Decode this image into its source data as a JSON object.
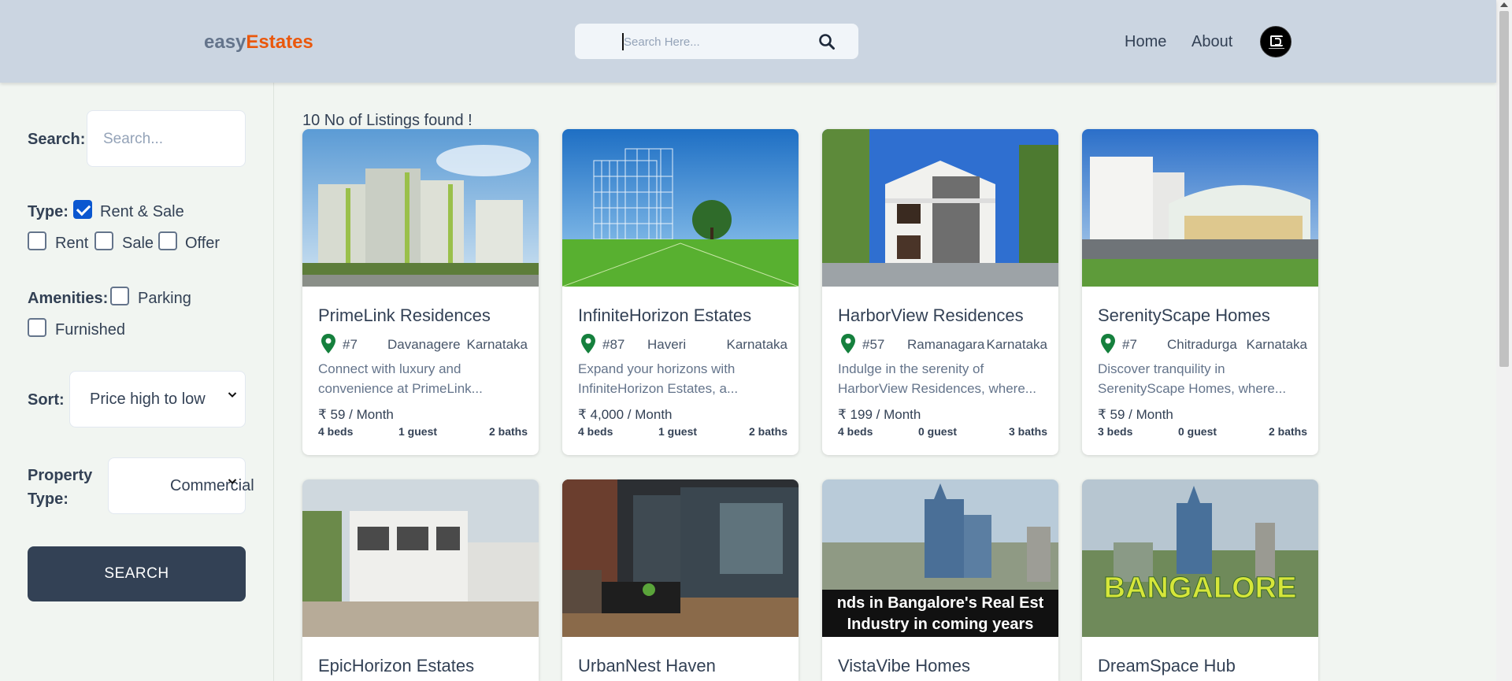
{
  "header": {
    "logo_part1": "easy",
    "logo_part2": "Estates",
    "search_placeholder": "Search Here...",
    "nav_home": "Home",
    "nav_about": "About"
  },
  "sidebar": {
    "search_label": "Search:",
    "search_placeholder": "Search...",
    "type_label": "Type:",
    "type_options": [
      {
        "label": "Rent & Sale",
        "checked": true
      },
      {
        "label": "Rent",
        "checked": false
      },
      {
        "label": "Sale",
        "checked": false
      },
      {
        "label": "Offer",
        "checked": false
      }
    ],
    "amenities_label": "Amenities:",
    "amenities_options": [
      {
        "label": "Parking",
        "checked": false
      },
      {
        "label": "Furnished",
        "checked": false
      }
    ],
    "sort_label": "Sort:",
    "sort_value": "Price high to low",
    "property_type_label_1": "Property",
    "property_type_label_2": "Type:",
    "property_type_value": "Commercial",
    "search_button": "SEARCH"
  },
  "main": {
    "found_text": "10 No of Listings found !",
    "listings": [
      {
        "title": "PrimeLink Residences",
        "number": "#7",
        "city": "Davanagere",
        "state": "Karnataka",
        "desc_line1": "Connect with luxury and",
        "desc_line2": "convenience at PrimeLink...",
        "price": "₹ 59 / Month",
        "beds": "4 beds",
        "guests": "1 guest",
        "baths": "2 baths"
      },
      {
        "title": "InfiniteHorizon Estates",
        "number": "#87",
        "city": "Haveri",
        "state": "Karnataka",
        "desc_line1": "Expand your horizons with",
        "desc_line2": "InfiniteHorizon Estates, a...",
        "price": "₹ 4,000 / Month",
        "beds": "4 beds",
        "guests": "1 guest",
        "baths": "2 baths"
      },
      {
        "title": "HarborView Residences",
        "number": "#57",
        "city": "Ramanagara",
        "state": "Karnataka",
        "desc_line1": "Indulge in the serenity of",
        "desc_line2": "HarborView Residences, where...",
        "price": "₹ 199 / Month",
        "beds": "4 beds",
        "guests": "0 guest",
        "baths": "3 baths"
      },
      {
        "title": "SerenityScape Homes",
        "number": "#7",
        "city": "Chitradurga",
        "state": "Karnataka",
        "desc_line1": "Discover tranquility in",
        "desc_line2": "SerenityScape Homes, where...",
        "price": "₹ 59 / Month",
        "beds": "3 beds",
        "guests": "0 guest",
        "baths": "2 baths"
      },
      {
        "title": "EpicHorizon Estates"
      },
      {
        "title": "UrbanNest Haven"
      },
      {
        "title": "VistaVibe Homes",
        "image_text_1": "nds in Bangalore's Real Est",
        "image_text_2": "Industry in coming years"
      },
      {
        "title": "DreamSpace Hub",
        "image_text": "BANGALORE"
      }
    ]
  },
  "colors": {
    "header_bg": "#cbd5e1",
    "page_bg": "#f1f5f1",
    "logo_accent": "#ea580c",
    "button_bg": "#334155",
    "pin_green": "#15803d",
    "checkbox_blue": "#0b57d0"
  },
  "icons": {
    "search": "search-icon",
    "pin": "map-pin-icon",
    "chevron": "chevron-down-icon"
  }
}
